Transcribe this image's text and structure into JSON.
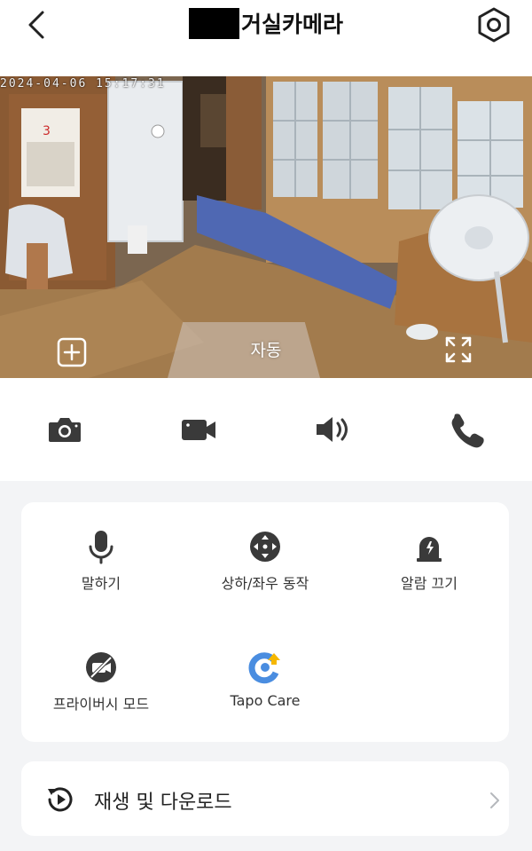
{
  "header": {
    "title": "거실카메라",
    "back_icon": "chevron-left-icon",
    "settings_icon": "gear-icon"
  },
  "video": {
    "timestamp": "2024-04-06 15:17:31",
    "mode_label": "자동",
    "add_icon": "add-square-icon",
    "fullscreen_icon": "fullscreen-icon"
  },
  "quick_actions": [
    {
      "icon": "camera-icon",
      "label": "snapshot"
    },
    {
      "icon": "video-camera-icon",
      "label": "record"
    },
    {
      "icon": "speaker-icon",
      "label": "audio"
    },
    {
      "icon": "phone-icon",
      "label": "call"
    }
  ],
  "features": [
    {
      "icon": "microphone-icon",
      "label": "말하기"
    },
    {
      "icon": "pan-tilt-icon",
      "label": "상하/좌우 동작"
    },
    {
      "icon": "alarm-icon",
      "label": "알람 끄기"
    },
    {
      "icon": "privacy-mode-icon",
      "label": "프라이버시 모드"
    },
    {
      "icon": "tapo-care-icon",
      "label": "Tapo Care"
    }
  ],
  "playback": {
    "label": "재생 및 다운로드",
    "icon": "playback-history-icon",
    "chevron_icon": "chevron-right-icon"
  },
  "colors": {
    "accent_blue": "#4a8de0",
    "accent_yellow": "#f5b700",
    "icon_dark": "#3a3a3a"
  }
}
